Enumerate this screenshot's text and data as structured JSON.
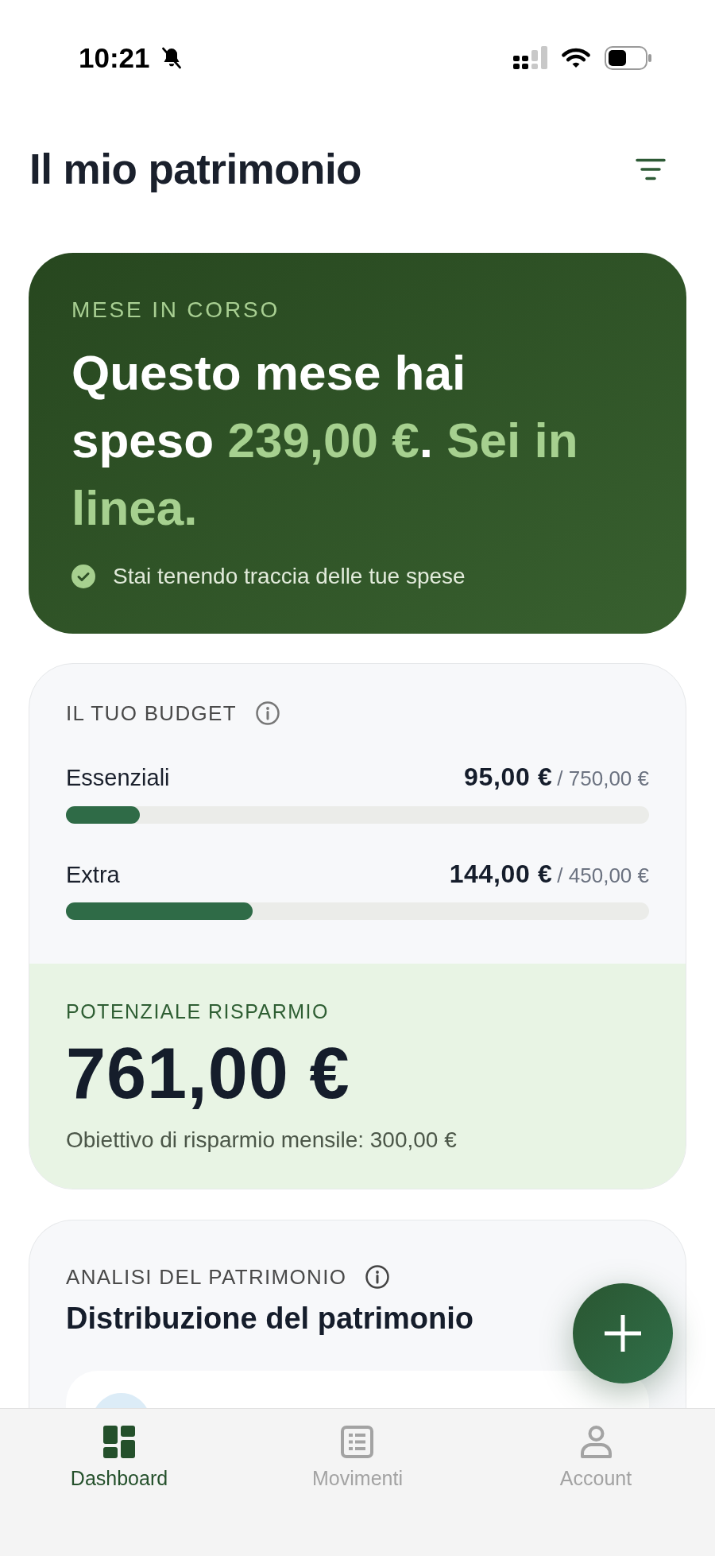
{
  "status_bar": {
    "time": "10:21"
  },
  "header": {
    "title": "Il mio patrimonio"
  },
  "month_card": {
    "label": "MESE IN CORSO",
    "summary": [
      {
        "text": "Questo mese hai speso ",
        "highlight": false
      },
      {
        "text": "239,00 €",
        "highlight": true
      },
      {
        "text": ". ",
        "highlight": false
      },
      {
        "text": "Sei in linea.",
        "highlight": true
      }
    ],
    "status": "Stai tenendo traccia delle tue spese"
  },
  "budget_card": {
    "title": "IL TUO BUDGET",
    "categories": [
      {
        "name": "Essenziali",
        "spent": "95,00 €",
        "limit": "/ 750,00 €",
        "level": 0.127
      },
      {
        "name": "Extra",
        "spent": "144,00 €",
        "limit": "/ 450,00 €",
        "level": 0.32
      }
    ]
  },
  "savings": {
    "label": "POTENZIALE RISPARMIO",
    "amount": "761,00 €",
    "goal": "Obiettivo di risparmio mensile: 300,00 €"
  },
  "analysis_card": {
    "label": "ANALISI DEL PATRIMONIO",
    "title": "Distribuzione del patrimonio"
  },
  "tab_bar": [
    {
      "label": "Dashboard",
      "selected": true
    },
    {
      "label": "Movimenti",
      "selected": false
    },
    {
      "label": "Account",
      "selected": false
    }
  ]
}
